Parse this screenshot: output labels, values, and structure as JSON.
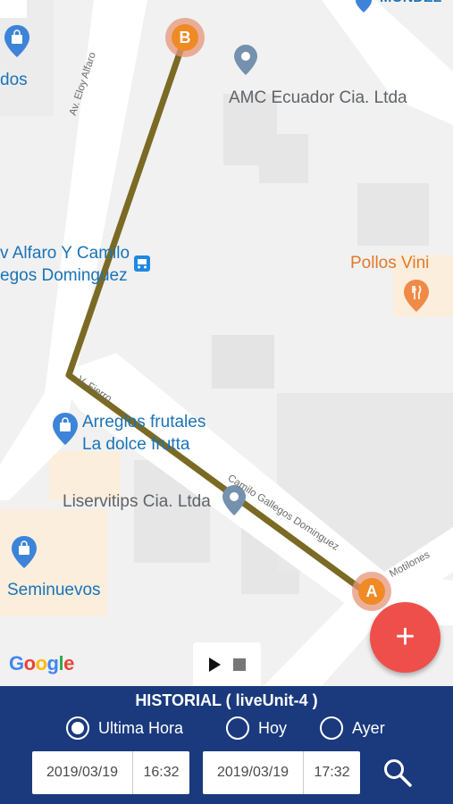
{
  "map": {
    "poi": {
      "dos": "dos",
      "amc": "AMC Ecuador Cia. Ltda",
      "alfaro_1": "v Alfaro Y Camilo",
      "alfaro_2": "egos Dominguez",
      "pollos": "Pollos Vini",
      "arreglos_1": "Arreglos frutales",
      "arreglos_2": "La dolce frutta",
      "liservitips": "Liservitips Cia. Ltda",
      "seminuevos": "Seminuevos",
      "mondel": "MONDEL"
    },
    "streets": {
      "eloy_alfaro": "Av. Eloy Alfaro",
      "v_fierro": "V. Fierro",
      "camilo": "Camilo Gallegos Dominguez",
      "motilones": "Motilones"
    },
    "markers": {
      "start": "A",
      "end": "B"
    },
    "route_color": "#7a6a23",
    "google_logo": [
      "G",
      "o",
      "o",
      "g",
      "l",
      "e"
    ]
  },
  "playback": {
    "play_icon": "play-icon",
    "stop_icon": "stop-icon"
  },
  "fab": {
    "label": "+"
  },
  "panel": {
    "title": "HISTORIAL ( liveUnit-4 )",
    "options": [
      {
        "label": "Ultima Hora",
        "selected": true
      },
      {
        "label": "Hoy",
        "selected": false
      },
      {
        "label": "Ayer",
        "selected": false
      }
    ],
    "from": {
      "date": "2019/03/19",
      "time": "16:32"
    },
    "to": {
      "date": "2019/03/19",
      "time": "17:32"
    },
    "search_icon": "search-icon",
    "bg_color": "#1a3a7d"
  }
}
